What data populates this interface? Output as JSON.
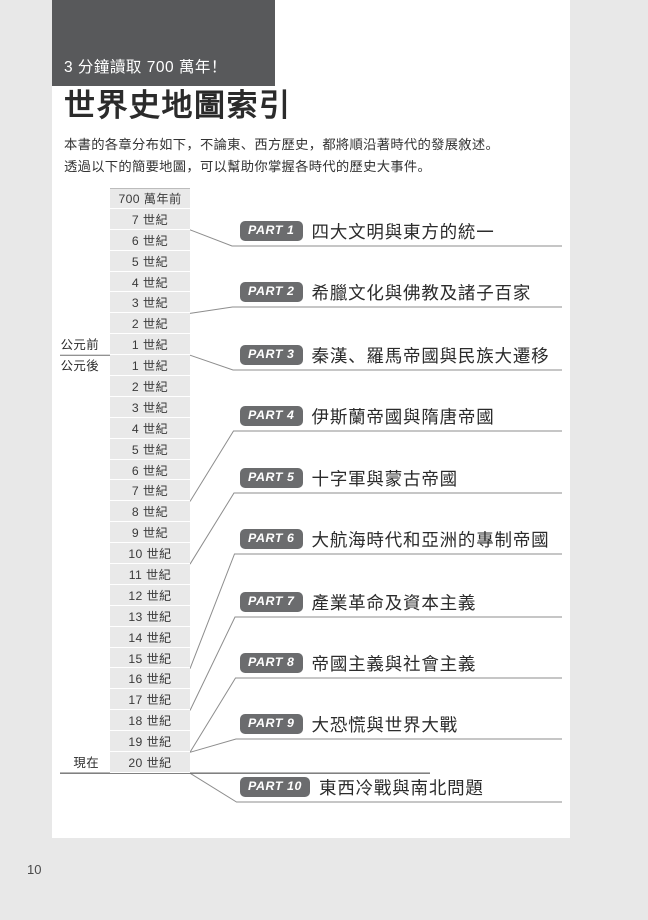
{
  "page": {
    "number": "10",
    "background_color": "#e8e8e8",
    "sheet_color": "#ffffff"
  },
  "header": {
    "kicker": "3 分鐘讀取 700 萬年！",
    "kicker_bg_color": "#58595b",
    "title": "世界史地圖索引",
    "intro_line_1": "本書的各章分布如下，不論東、西方歷史，都將順沿著時代的發展敘述。",
    "intro_line_2": "透過以下的簡要地圖，可以幫助你掌握各時代的歷史大事件。"
  },
  "timeline": {
    "left_captions": {
      "bc": "公元前",
      "ad": "公元後",
      "now": "現在"
    },
    "rows": [
      {
        "label": "700 萬年前",
        "era_caption": ""
      },
      {
        "label": "7 世紀",
        "era_caption": ""
      },
      {
        "label": "6 世紀",
        "era_caption": ""
      },
      {
        "label": "5 世紀",
        "era_caption": ""
      },
      {
        "label": "4 世紀",
        "era_caption": ""
      },
      {
        "label": "3 世紀",
        "era_caption": ""
      },
      {
        "label": "2 世紀",
        "era_caption": ""
      },
      {
        "label": "1 世紀",
        "era_caption": "公元前"
      },
      {
        "label": "1 世紀",
        "era_caption": "公元後"
      },
      {
        "label": "2 世紀",
        "era_caption": ""
      },
      {
        "label": "3 世紀",
        "era_caption": ""
      },
      {
        "label": "4 世紀",
        "era_caption": ""
      },
      {
        "label": "5 世紀",
        "era_caption": ""
      },
      {
        "label": "6 世紀",
        "era_caption": ""
      },
      {
        "label": "7 世紀",
        "era_caption": ""
      },
      {
        "label": "8 世紀",
        "era_caption": ""
      },
      {
        "label": "9 世紀",
        "era_caption": ""
      },
      {
        "label": "10 世紀",
        "era_caption": ""
      },
      {
        "label": "11 世紀",
        "era_caption": ""
      },
      {
        "label": "12 世紀",
        "era_caption": ""
      },
      {
        "label": "13 世紀",
        "era_caption": ""
      },
      {
        "label": "14 世紀",
        "era_caption": ""
      },
      {
        "label": "15 世紀",
        "era_caption": ""
      },
      {
        "label": "16 世紀",
        "era_caption": ""
      },
      {
        "label": "17 世紀",
        "era_caption": ""
      },
      {
        "label": "18 世紀",
        "era_caption": ""
      },
      {
        "label": "19 世紀",
        "era_caption": ""
      },
      {
        "label": "20 世紀",
        "era_caption": "現在"
      }
    ]
  },
  "parts": [
    {
      "badge": "PART 1",
      "title": "四大文明與東方的統一"
    },
    {
      "badge": "PART 2",
      "title": "希臘文化與佛教及諸子百家"
    },
    {
      "badge": "PART 3",
      "title": "秦漢、羅馬帝國與民族大遷移"
    },
    {
      "badge": "PART 4",
      "title": "伊斯蘭帝國與隋唐帝國"
    },
    {
      "badge": "PART 5",
      "title": "十字軍與蒙古帝國"
    },
    {
      "badge": "PART 6",
      "title": "大航海時代和亞洲的專制帝國"
    },
    {
      "badge": "PART 7",
      "title": "產業革命及資本主義"
    },
    {
      "badge": "PART 8",
      "title": "帝國主義與社會主義"
    },
    {
      "badge": "PART 9",
      "title": "大恐慌與世界大戰"
    },
    {
      "badge": "PART 10",
      "title": "東西冷戰與南北問題"
    }
  ],
  "colors": {
    "badge_bg": "#6b6c6e",
    "row_bg": "#e9e9e9",
    "rule": "#9a9a9a",
    "text": "#2b2b2b"
  }
}
